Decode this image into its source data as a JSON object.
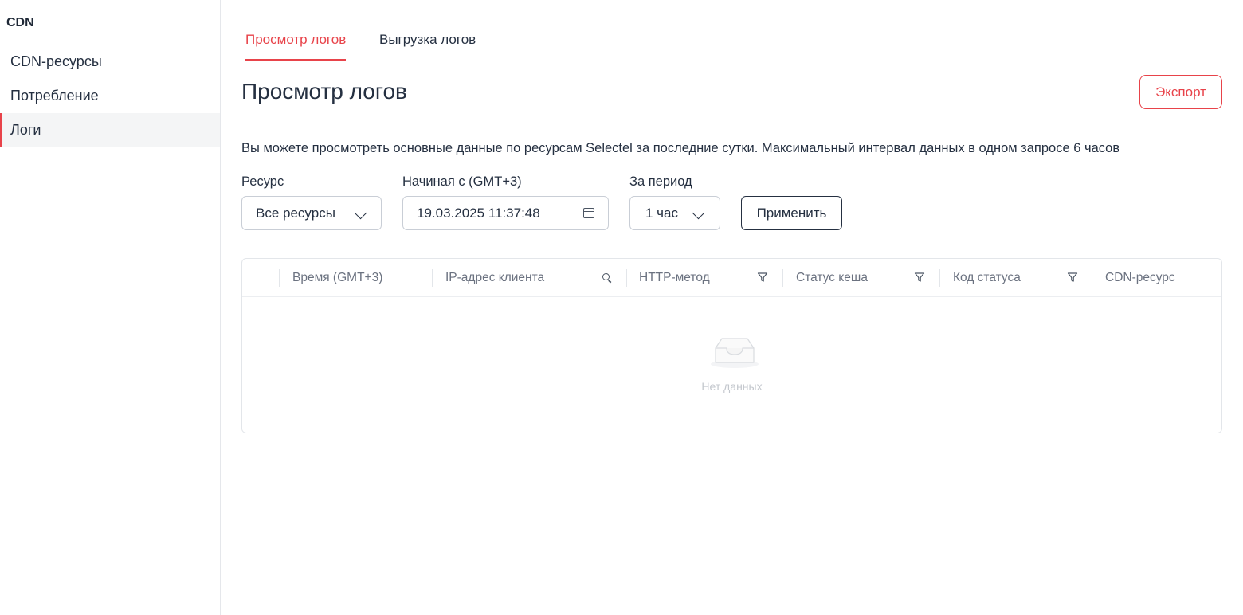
{
  "sidebar": {
    "title": "CDN",
    "items": [
      {
        "label": "CDN-ресурсы"
      },
      {
        "label": "Потребление"
      },
      {
        "label": "Логи"
      }
    ]
  },
  "tabs": [
    {
      "label": "Просмотр логов"
    },
    {
      "label": "Выгрузка логов"
    }
  ],
  "page": {
    "title": "Просмотр логов",
    "export_label": "Экспорт",
    "description": "Вы можете просмотреть основные данные по ресурсам Selectel за последние сутки. Максимальный интервал данных в одном запросе 6 часов"
  },
  "filters": {
    "resource_label": "Ресурс",
    "resource_value": "Все ресурсы",
    "start_label": "Начиная с (GMT+3)",
    "start_value": "19.03.2025 11:37:48",
    "period_label": "За период",
    "period_value": "1 час",
    "apply_label": "Применить"
  },
  "table": {
    "columns": [
      {
        "label": "Время (GMT+3)"
      },
      {
        "label": "IP-адрес клиента",
        "icon": "search-icon"
      },
      {
        "label": "HTTP-метод",
        "icon": "filter-icon"
      },
      {
        "label": "Статус кеша",
        "icon": "filter-icon"
      },
      {
        "label": "Код статуса",
        "icon": "filter-icon"
      },
      {
        "label": "CDN-ресурс"
      }
    ],
    "empty_text": "Нет данных"
  },
  "colors": {
    "accent": "#e8434a",
    "text": "#253041",
    "muted": "#6b7280"
  }
}
